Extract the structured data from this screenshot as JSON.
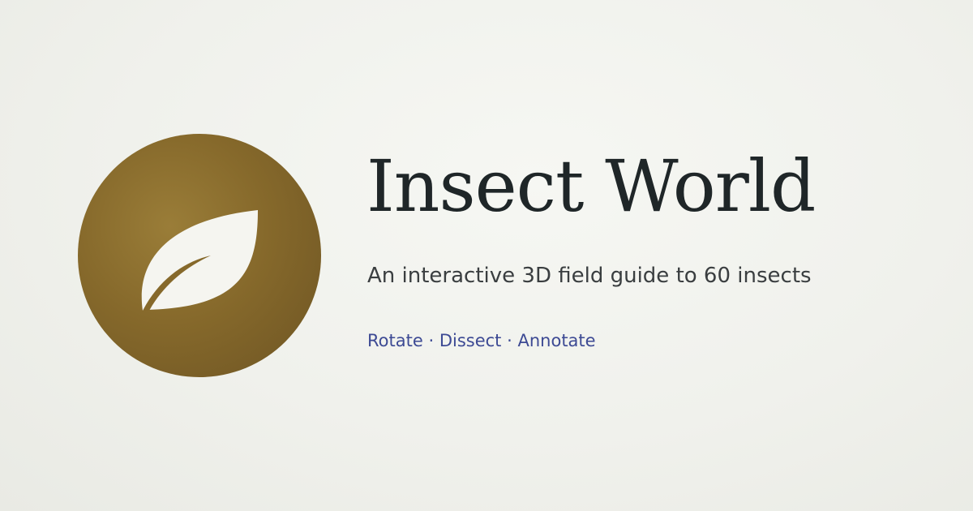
{
  "logo": {
    "icon": "leaf-icon",
    "circle_color": "#86692b",
    "leaf_color": "#f5f5f0"
  },
  "title": "Insect World",
  "subtitle": "An interactive 3D field guide to 60 insects",
  "features": {
    "items": [
      "Rotate",
      "Dissect",
      "Annotate"
    ],
    "separator": "·",
    "color": "#3d4a94"
  }
}
